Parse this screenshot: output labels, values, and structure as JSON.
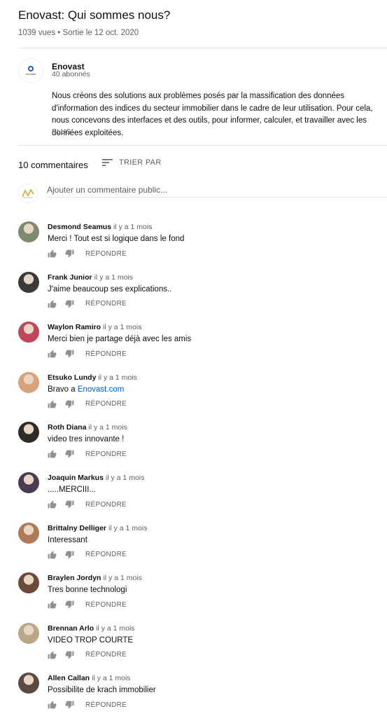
{
  "video": {
    "title": "Enovast: Qui sommes nous?",
    "meta": "1039 vues • Sortie le 12 oct. 2020"
  },
  "channel": {
    "logo_text": "enovast",
    "name": "Enovast",
    "subscribers": "40 abonnés",
    "description": "Nous créons des solutions aux problèmes posés par la massification des données d'information des indices du secteur immobilier dans le cadre de leur utilisation. Pour cela, nous concevons des interfaces et des outils, pour informer, calculer, et travailler avec les données exploitées.",
    "more_label": "PLUS"
  },
  "comments_section": {
    "count_label": "10 commentaires",
    "sort_label": "TRIER PAR",
    "add_placeholder": "Ajouter un commentaire public...",
    "reply_label": "RÉPONDRE",
    "icons": {
      "like": "thumb-up-icon",
      "dislike": "thumb-down-icon",
      "sort": "sort-icon"
    },
    "items": [
      {
        "author": "Desmond Seamus",
        "time": "il y a 1 mois",
        "text": "Merci ! Tout est si logique dans le fond",
        "avatar_color": "#7c8a6e"
      },
      {
        "author": "Frank Junior",
        "time": "il y a 1 mois",
        "text": "J'aime beaucoup ses explications..",
        "avatar_color": "#3a3a3a"
      },
      {
        "author": "Waylon Ramiro",
        "time": "il y a 1 mois",
        "text": "Merci bien je partage déjà avec les amis",
        "avatar_color": "#c0475a"
      },
      {
        "author": "Etsuko Lundy",
        "time": "il y a 1 mois",
        "text_prefix": "Bravo a ",
        "link": "Enovast.com",
        "avatar_color": "#d9a27a"
      },
      {
        "author": "Roth Diana",
        "time": "il y a 1 mois",
        "text": "video tres innovante !",
        "avatar_color": "#2d2a28"
      },
      {
        "author": "Joaquin Markus",
        "time": "il y a 1 mois",
        "text": ".....MERCIII...",
        "avatar_color": "#4a3b52"
      },
      {
        "author": "Brittalny Delliger",
        "time": "il y a 1 mois",
        "text": "Interessant",
        "avatar_color": "#b07a5a"
      },
      {
        "author": "Braylen Jordyn",
        "time": "il y a 1 mois",
        "text": "Tres bonne technologi",
        "avatar_color": "#6b4a3a"
      },
      {
        "author": "Brennan Arlo",
        "time": "il y a 1 mois",
        "text": "VIDEO TROP COURTE",
        "avatar_color": "#b9a888"
      },
      {
        "author": "Allen Callan",
        "time": "il y a 1 mois",
        "text": "Possibilite de krach immobilier",
        "avatar_color": "#5a4a42"
      }
    ]
  }
}
